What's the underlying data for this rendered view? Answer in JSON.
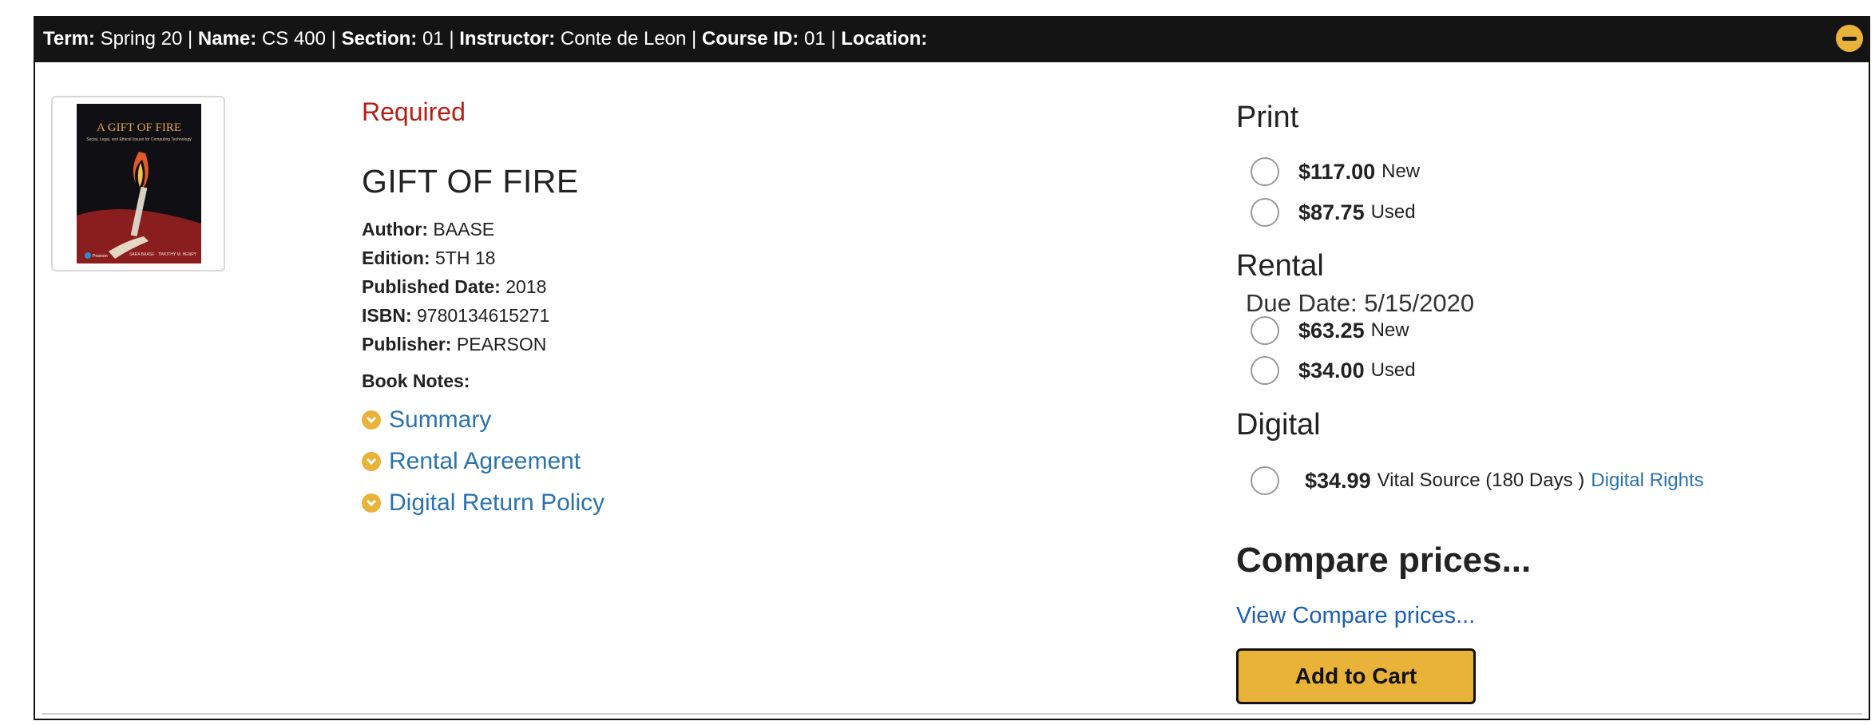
{
  "header": {
    "term_label": "Term:",
    "term": "Spring 20",
    "name_label": "Name:",
    "name": "CS 400",
    "section_label": "Section:",
    "section": "01",
    "instructor_label": "Instructor:",
    "instructor": "Conte de Leon",
    "course_id_label": "Course ID:",
    "course_id": "01",
    "location_label": "Location:",
    "location": "",
    "sep": "|",
    "collapse_icon": "minus-circle-icon",
    "accent": "#e9b33a"
  },
  "book": {
    "cover_title": "A GIFT OF FIRE",
    "cover_subtitle": "Social, Legal, and Ethical Issues for Computing Technology",
    "cover_authors": "SARA BAASE · TIMOTHY M. HENRY",
    "cover_publisher": "Pearson",
    "status": "Required",
    "title": "GIFT OF FIRE",
    "author_label": "Author:",
    "author": "BAASE",
    "edition_label": "Edition:",
    "edition": "5TH 18",
    "published_label": "Published Date:",
    "published": "2018",
    "isbn_label": "ISBN:",
    "isbn": "9780134615271",
    "publisher_label": "Publisher:",
    "publisher": "PEARSON",
    "notes_label": "Book Notes:",
    "notes": [
      {
        "label": "Summary",
        "icon": "chevron-down-icon"
      },
      {
        "label": "Rental Agreement",
        "icon": "chevron-down-icon"
      },
      {
        "label": "Digital Return Policy",
        "icon": "chevron-down-icon"
      }
    ]
  },
  "pricing": {
    "print": {
      "heading": "Print",
      "options": [
        {
          "price": "$117.00",
          "condition": "New"
        },
        {
          "price": "$87.75",
          "condition": "Used"
        }
      ]
    },
    "rental": {
      "heading": "Rental",
      "due": "Due Date: 5/15/2020",
      "options": [
        {
          "price": "$63.25",
          "condition": "New"
        },
        {
          "price": "$34.00",
          "condition": "Used"
        }
      ]
    },
    "digital": {
      "heading": "Digital",
      "price": "$34.99",
      "source": "Vital Source (180 Days )",
      "rights_link": "Digital Rights"
    },
    "compare_heading": "Compare prices...",
    "compare_link": "View Compare prices...",
    "add_to_cart": "Add to Cart"
  }
}
